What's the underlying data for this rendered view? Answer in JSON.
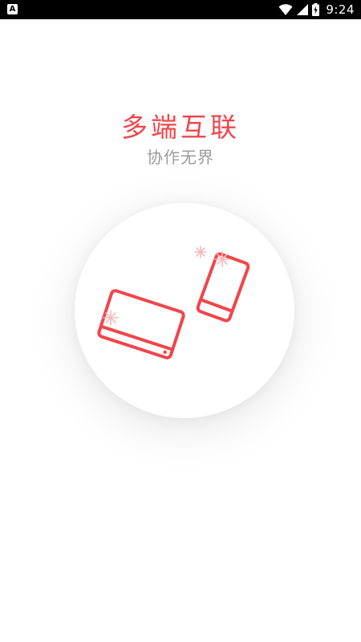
{
  "status_bar": {
    "app_icon_letter": "A",
    "time": "9:24"
  },
  "onboarding": {
    "title": "多端互联",
    "subtitle": "协作无界",
    "accent_color": "#f0464b",
    "subtitle_color": "#9b9b9b",
    "illustration_icon": "tablet-phone-connect-icon"
  }
}
